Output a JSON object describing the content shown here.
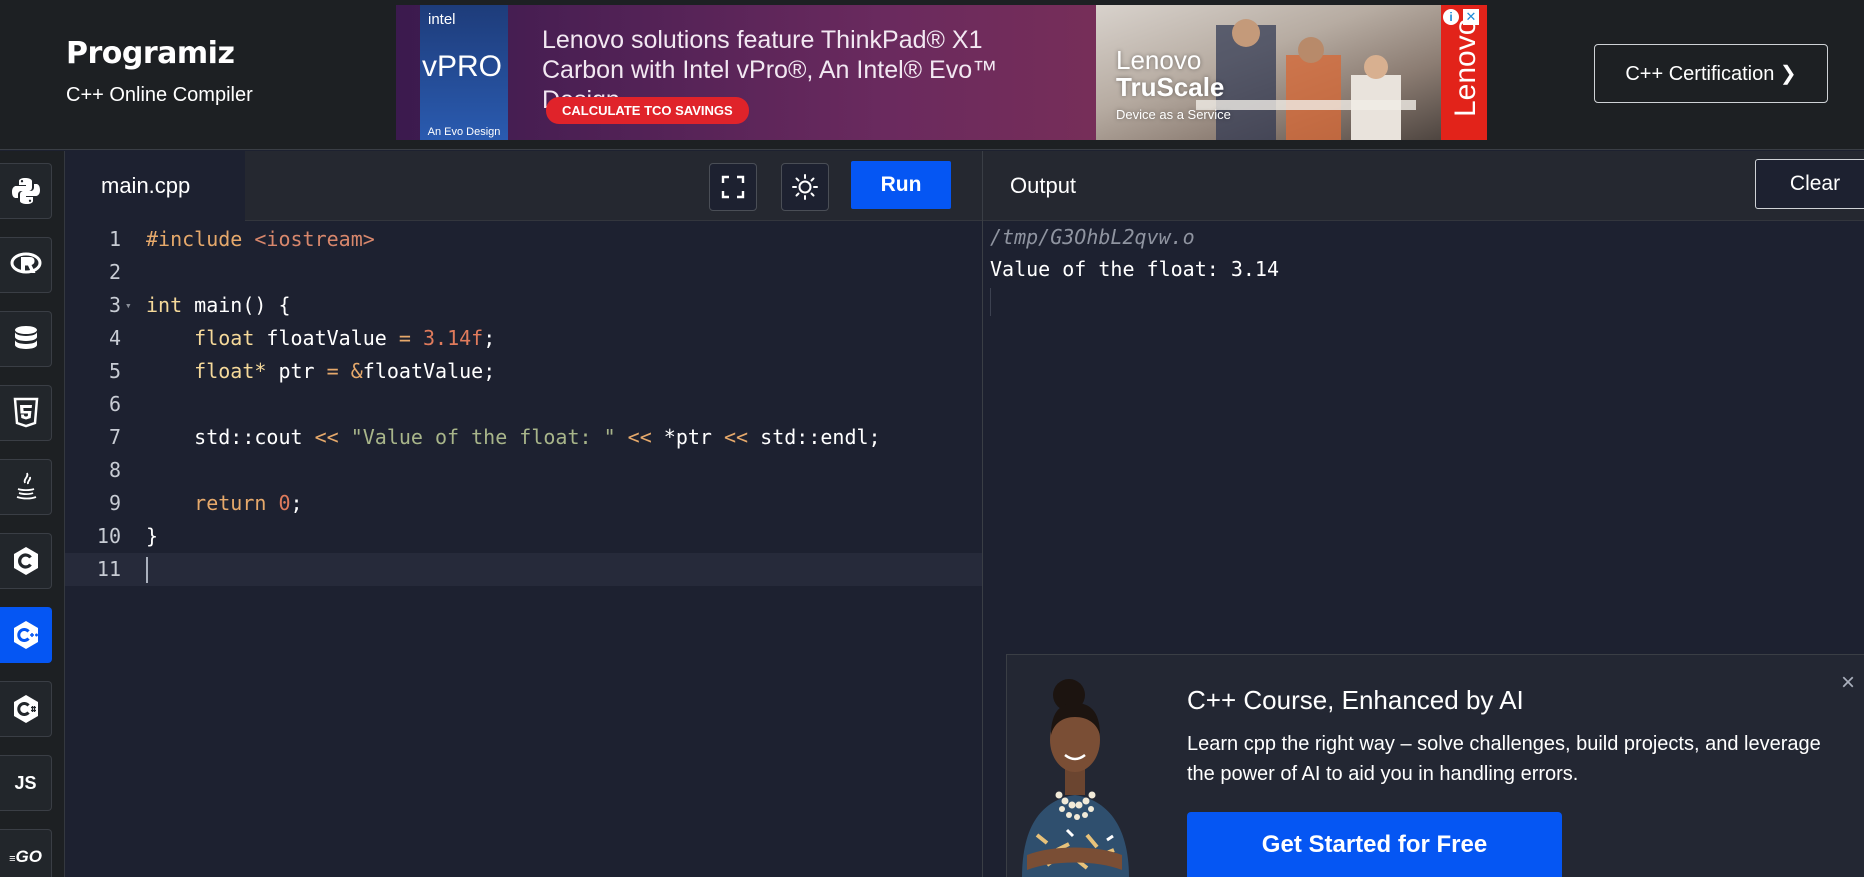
{
  "header": {
    "logo": "Programiz",
    "subtitle": "C++ Online Compiler",
    "cert_button": "C++ Certification ❯"
  },
  "ad": {
    "chip_brand": "intel",
    "chip_name": "vPRO",
    "chip_foot": "An Evo Design",
    "text": "Lenovo solutions feature ThinkPad® X1 Carbon with Intel vPro®, An Intel® Evo™ Design.",
    "cta": "CALCULATE TCO SAVINGS",
    "photo_brand_line1": "Lenovo",
    "photo_brand_line2": "TruScale",
    "photo_foot": "Device as a Service",
    "side_brand": "Lenovo"
  },
  "sidebar": {
    "items": [
      {
        "name": "python-icon"
      },
      {
        "name": "r-icon"
      },
      {
        "name": "sql-icon"
      },
      {
        "name": "html-icon"
      },
      {
        "name": "java-icon"
      },
      {
        "name": "c-icon"
      },
      {
        "name": "cpp-icon",
        "active": true
      },
      {
        "name": "csharp-icon"
      },
      {
        "name": "js-icon",
        "label": "JS"
      },
      {
        "name": "go-icon",
        "label": "GO"
      }
    ]
  },
  "editor": {
    "file_tab": "main.cpp",
    "run_label": "Run",
    "lines": [
      "1",
      "2",
      "3",
      "4",
      "5",
      "6",
      "7",
      "8",
      "9",
      "10",
      "11"
    ],
    "code": {
      "l1_inc": "#include",
      "l1_hdr": "<iostream>",
      "l3_type": "int",
      "l3_rest": " main() {",
      "l4_type": "float",
      "l4_name": " floatValue ",
      "l4_eq": "=",
      "l4_num": "3.14f",
      "l4_end": ";",
      "l5_type": "float*",
      "l5_name": " ptr ",
      "l5_eq": "=",
      "l5_amp": " &",
      "l5_rest": "floatValue;",
      "l7_a": "std::cout ",
      "l7_op1": "<<",
      "l7_str": " \"Value of the float: \" ",
      "l7_op2": "<<",
      "l7_ptr": " *ptr ",
      "l7_op3": "<<",
      "l7_end": " std::endl;",
      "l9_kw": "return",
      "l9_num": " 0",
      "l9_end": ";",
      "l10": "}"
    }
  },
  "output": {
    "title": "Output",
    "clear_label": "Clear",
    "path": "/tmp/G3OhbL2qvw.o",
    "result": "Value of the float: 3.14"
  },
  "promo": {
    "title": "C++ Course, Enhanced by AI",
    "text": "Learn cpp the right way – solve challenges, build projects, and leverage the power of AI to aid you in handling errors.",
    "button": "Get Started for Free",
    "close": "×"
  },
  "colors": {
    "accent": "#0556f3",
    "background": "#1d2130",
    "header": "#1d2023"
  }
}
